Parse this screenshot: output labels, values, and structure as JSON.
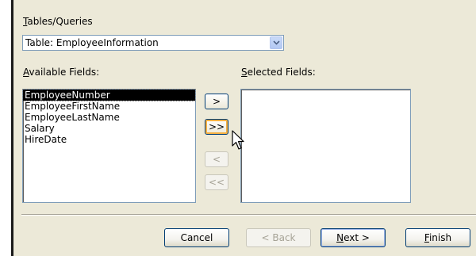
{
  "source": {
    "label": "Tables/Queries",
    "selected": "Table: EmployeeInformation"
  },
  "available": {
    "label": "Available Fields:",
    "items": [
      "EmployeeNumber",
      "EmployeeFirstName",
      "EmployeeLastName",
      "Salary",
      "HireDate"
    ]
  },
  "selected_fields": {
    "label": "Selected Fields:",
    "items": []
  },
  "movers": {
    "add_one": ">",
    "add_all": ">>",
    "remove_one": "<",
    "remove_all": "<<"
  },
  "footer": {
    "cancel": "Cancel",
    "back": "< Back",
    "next": "Next >",
    "finish": "Finish"
  }
}
